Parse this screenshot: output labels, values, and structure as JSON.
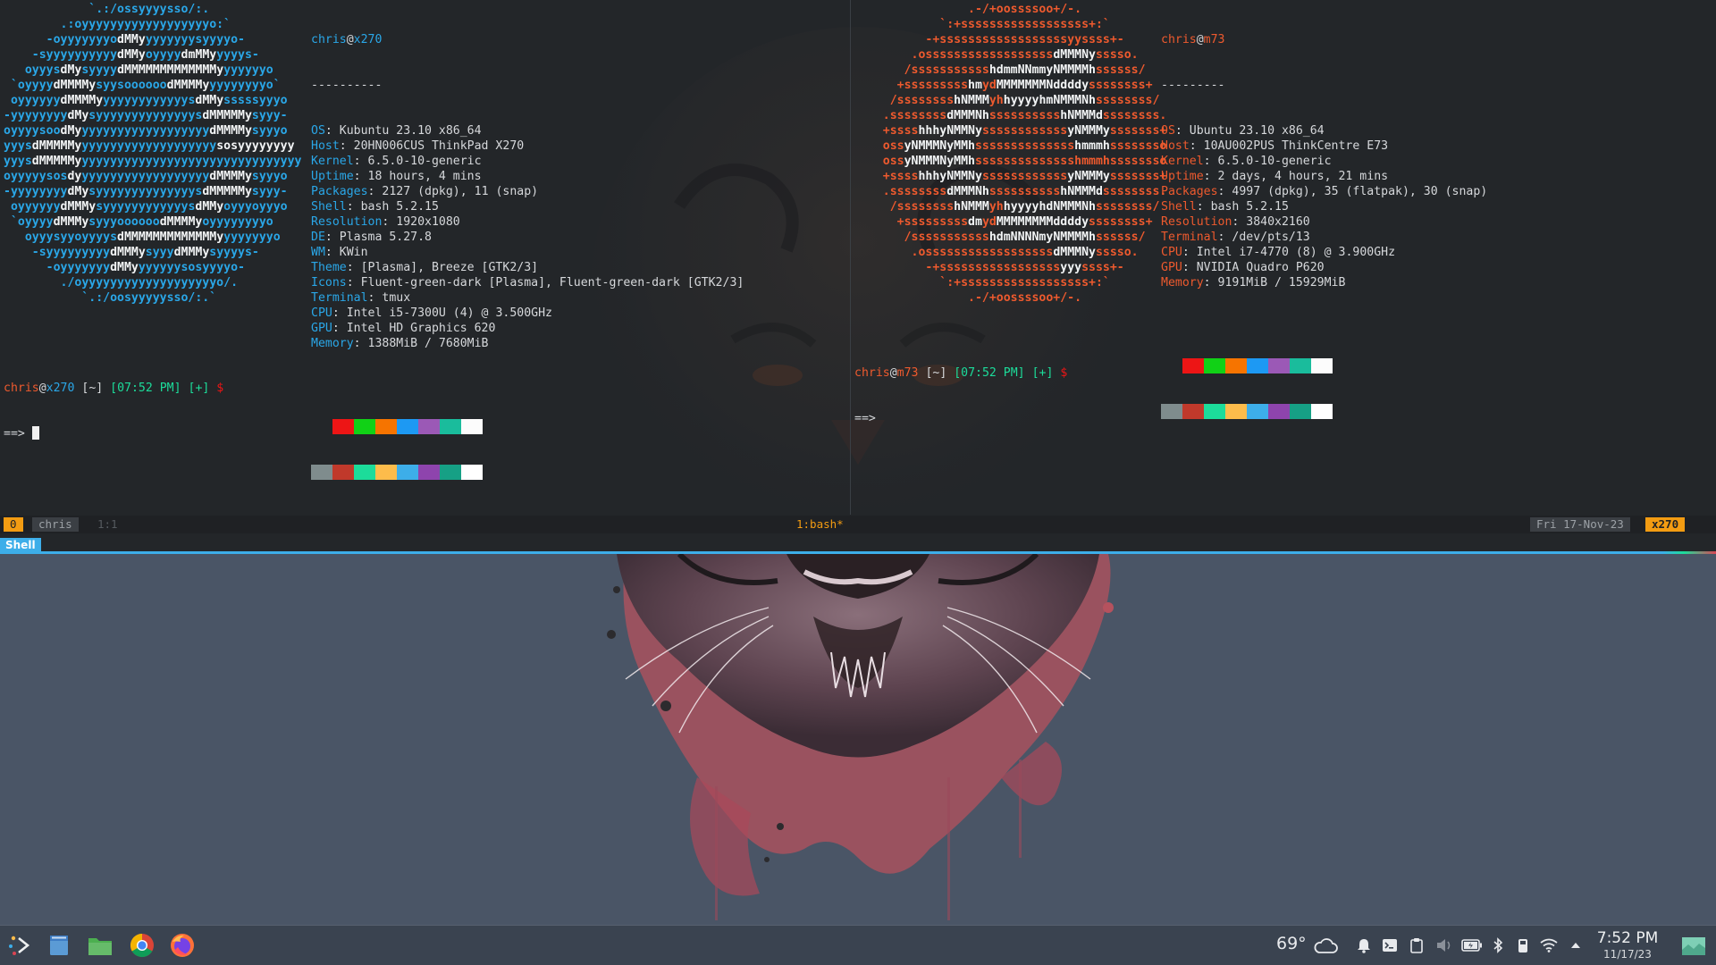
{
  "terminal": {
    "left": {
      "logo_lines": [
        [
          "            `.:/ossyyyysso/:.",
          ""
        ],
        [
          "        .:oyyyyyyyyyyyyyyyyyyo:`",
          ""
        ],
        [
          "      -oyyyyyyyo",
          "dMMy",
          "yyyyyyysyyyyo-"
        ],
        [
          "    -syyyyyyyyyy",
          "dMMy",
          "oyyyy",
          "dmMMy",
          "yyyys-"
        ],
        [
          "   oyyys",
          "dMy",
          "syyyy",
          "dMMMMMMMMMMMMMy",
          "yyyyyyo"
        ],
        [
          " `oyyyy",
          "dMMMMy",
          "syysoooooo",
          "dMMMMy",
          "yyyyyyyyo`"
        ],
        [
          " oyyyyyy",
          "dMMMMy",
          "yyyyyyyyyyyys",
          "dMMy",
          "sssssyyyo"
        ],
        [
          "-yyyyyyyy",
          "dMy",
          "syyyyyyyyyyyyyys",
          "dMMMMMy",
          "syyy-"
        ],
        [
          "oyyyysoo",
          "dMy",
          "yyyyyyyyyyyyyyyyyy",
          "dMMMMy",
          "syyyo"
        ],
        [
          "yyys",
          "dMMMMMy",
          "yyyyyyyyyyyyyyyyyyy",
          "sosyyyyyyyy"
        ],
        [
          "yyys",
          "dMMMMMy",
          "yyyyyyyyyyyyyyyyyyyyyyyyyyyyyyy"
        ],
        [
          "oyyyyysos",
          "dy",
          "yyyyyyyyyyyyyyyyyy",
          "dMMMMy",
          "syyyo"
        ],
        [
          "-yyyyyyyy",
          "dMy",
          "syyyyyyyyyyyyyys",
          "dMMMMMy",
          "syyy-"
        ],
        [
          " oyyyyyy",
          "dMMMy",
          "syyyyyyyyyyyys",
          "dMMy",
          "oyyyoyyyo"
        ],
        [
          " `oyyyy",
          "dMMMy",
          "syyyoooooo",
          "dMMMMy",
          "oyyyyyyyyo"
        ],
        [
          "   oyyysyyoyyyys",
          "dMMMMMMMMMMMMMy",
          "yyyyyyyo"
        ],
        [
          "    -syyyyyyyyy",
          "dMMMy",
          "syyy",
          "dMMMy",
          "syyyys-"
        ],
        [
          "      -oyyyyyyy",
          "dMMy",
          "yyyyyysosyyyyo-"
        ],
        [
          "        ./oyyyyyyyyyyyyyyyyyyyo/.",
          ""
        ],
        [
          "           `.:/oosyyyyysso/:.`",
          ""
        ]
      ],
      "user": "chris",
      "at": "@",
      "host": "x270",
      "separator": "----------",
      "info": [
        {
          "key": "OS",
          "value": ": Kubuntu 23.10 x86_64"
        },
        {
          "key": "Host",
          "value": ": 20HN006CUS ThinkPad X270"
        },
        {
          "key": "Kernel",
          "value": ": 6.5.0-10-generic"
        },
        {
          "key": "Uptime",
          "value": ": 18 hours, 4 mins"
        },
        {
          "key": "Packages",
          "value": ": 2127 (dpkg), 11 (snap)"
        },
        {
          "key": "Shell",
          "value": ": bash 5.2.15"
        },
        {
          "key": "Resolution",
          "value": ": 1920x1080"
        },
        {
          "key": "DE",
          "value": ": Plasma 5.27.8"
        },
        {
          "key": "WM",
          "value": ": KWin"
        },
        {
          "key": "Theme",
          "value": ": [Plasma], Breeze [GTK2/3]"
        },
        {
          "key": "Icons",
          "value": ": Fluent-green-dark [Plasma], Fluent-green-dark [GTK2/3]"
        },
        {
          "key": "Terminal",
          "value": ": tmux"
        },
        {
          "key": "CPU",
          "value": ": Intel i5-7300U (4) @ 3.500GHz"
        },
        {
          "key": "GPU",
          "value": ": Intel HD Graphics 620"
        },
        {
          "key": "Memory",
          "value": ": 1388MiB / 7680MiB"
        }
      ],
      "prompt": {
        "user": "chris",
        "at": "@",
        "host": "x270",
        "path": "[~]",
        "time": "[07:52 PM]",
        "plus": "[+]",
        "dollar": "$",
        "arrow": "==>"
      }
    },
    "right": {
      "logo_lines": [
        [
          "                .-/+oossssoo+/-.",
          ""
        ],
        [
          "            `:+ssssssssssssssssss+:`",
          ""
        ],
        [
          "          -+ssssssssssssssssssyyssss+-",
          ""
        ],
        [
          "        .ossssssssssssssssss",
          "dMMMNy",
          "sssso."
        ],
        [
          "       /sssssssssss",
          "hdmmNNmmyNMMMMh",
          "ssssss/"
        ],
        [
          "      +sssssssss",
          "hm",
          "yd",
          "MMMMMMMNddddy",
          "ssssssss+"
        ],
        [
          "     /ssssssss",
          "hNMMM",
          "yh",
          "hyyyyhmNMMMNh",
          "ssssssss/"
        ],
        [
          "    .ssssssss",
          "dMMMNh",
          "ssssssssss",
          "hNMMMd",
          "ssssssss."
        ],
        [
          "    +ssss",
          "hhhyNMMNy",
          "ssssssssssss",
          "yNMMMy",
          "sssssss+"
        ],
        [
          "    oss",
          "yNMMMNyMMh",
          "ssssssssssssss",
          "hmmmh",
          "ssssssso"
        ],
        [
          "    oss",
          "yNMMMNyMMh",
          "sssssssssssssshmmmhssssssso",
          ""
        ],
        [
          "    +ssss",
          "hhhyNMMNy",
          "ssssssssssss",
          "yNMMMy",
          "sssssss+"
        ],
        [
          "    .ssssssss",
          "dMMMNh",
          "ssssssssss",
          "hNMMMd",
          "ssssssss."
        ],
        [
          "     /ssssssss",
          "hNMMM",
          "yh",
          "hyyyyhdNMMMNh",
          "ssssssss/"
        ],
        [
          "      +sssssssss",
          "dm",
          "yd",
          "MMMMMMMMddddy",
          "ssssssss+"
        ],
        [
          "       /sssssssssss",
          "hdmNNNNmyNMMMMh",
          "ssssss/"
        ],
        [
          "        .ossssssssssssssssss",
          "dMMMNy",
          "sssso."
        ],
        [
          "          -+sssssssssssssssss",
          "yyy",
          "ssss+-"
        ],
        [
          "            `:+ssssssssssssssssss+:`",
          ""
        ],
        [
          "                .-/+oossssoo+/-.",
          ""
        ]
      ],
      "user": "chris",
      "at": "@",
      "host": "m73",
      "separator": "---------",
      "info": [
        {
          "key": "OS",
          "value": ": Ubuntu 23.10 x86_64"
        },
        {
          "key": "Host",
          "value": ": 10AU002PUS ThinkCentre E73"
        },
        {
          "key": "Kernel",
          "value": ": 6.5.0-10-generic"
        },
        {
          "key": "Uptime",
          "value": ": 2 days, 4 hours, 21 mins"
        },
        {
          "key": "Packages",
          "value": ": 4997 (dpkg), 35 (flatpak), 30 (snap)"
        },
        {
          "key": "Shell",
          "value": ": bash 5.2.15"
        },
        {
          "key": "Resolution",
          "value": ": 3840x2160"
        },
        {
          "key": "Terminal",
          "value": ": /dev/pts/13"
        },
        {
          "key": "CPU",
          "value": ": Intel i7-4770 (8) @ 3.900GHz"
        },
        {
          "key": "GPU",
          "value": ": NVIDIA Quadro P620"
        },
        {
          "key": "Memory",
          "value": ": 9191MiB / 15929MiB"
        }
      ],
      "prompt": {
        "user": "chris",
        "at": "@",
        "host": "m73",
        "path": "[~]",
        "time": "[07:52 PM]",
        "plus": "[+]",
        "dollar": "$",
        "arrow": "==>"
      }
    },
    "palette_top": [
      "#232629",
      "#ed1515",
      "#11d116",
      "#f67400",
      "#1d99f3",
      "#9b59b6",
      "#1abc9c",
      "#fcfcfc"
    ],
    "palette_bottom": [
      "#7f8c8d",
      "#c0392b",
      "#1cdc9a",
      "#fdbc4b",
      "#3daee9",
      "#8e44ad",
      "#16a085",
      "#ffffff"
    ],
    "tmux": {
      "session_num": "0",
      "user": "chris",
      "pane_pos": "1:1",
      "window": "1:bash*",
      "date": "Fri 17-Nov-23",
      "host": "x270"
    },
    "tab_label": "Shell"
  },
  "taskbar": {
    "apps": [
      "launcher-icon",
      "notes-icon",
      "files-icon",
      "chrome-icon",
      "firefox-icon"
    ],
    "weather_temp": "69°",
    "clock_time": "7:52 PM",
    "clock_date": "11/17/23"
  },
  "colors": {
    "terminal_bg": "#232629",
    "desktop_bg": "#4a5566",
    "accent_blue": "#2aa7e8",
    "accent_orange": "#ee5a2e",
    "tmux_orange": "#f39c12"
  }
}
